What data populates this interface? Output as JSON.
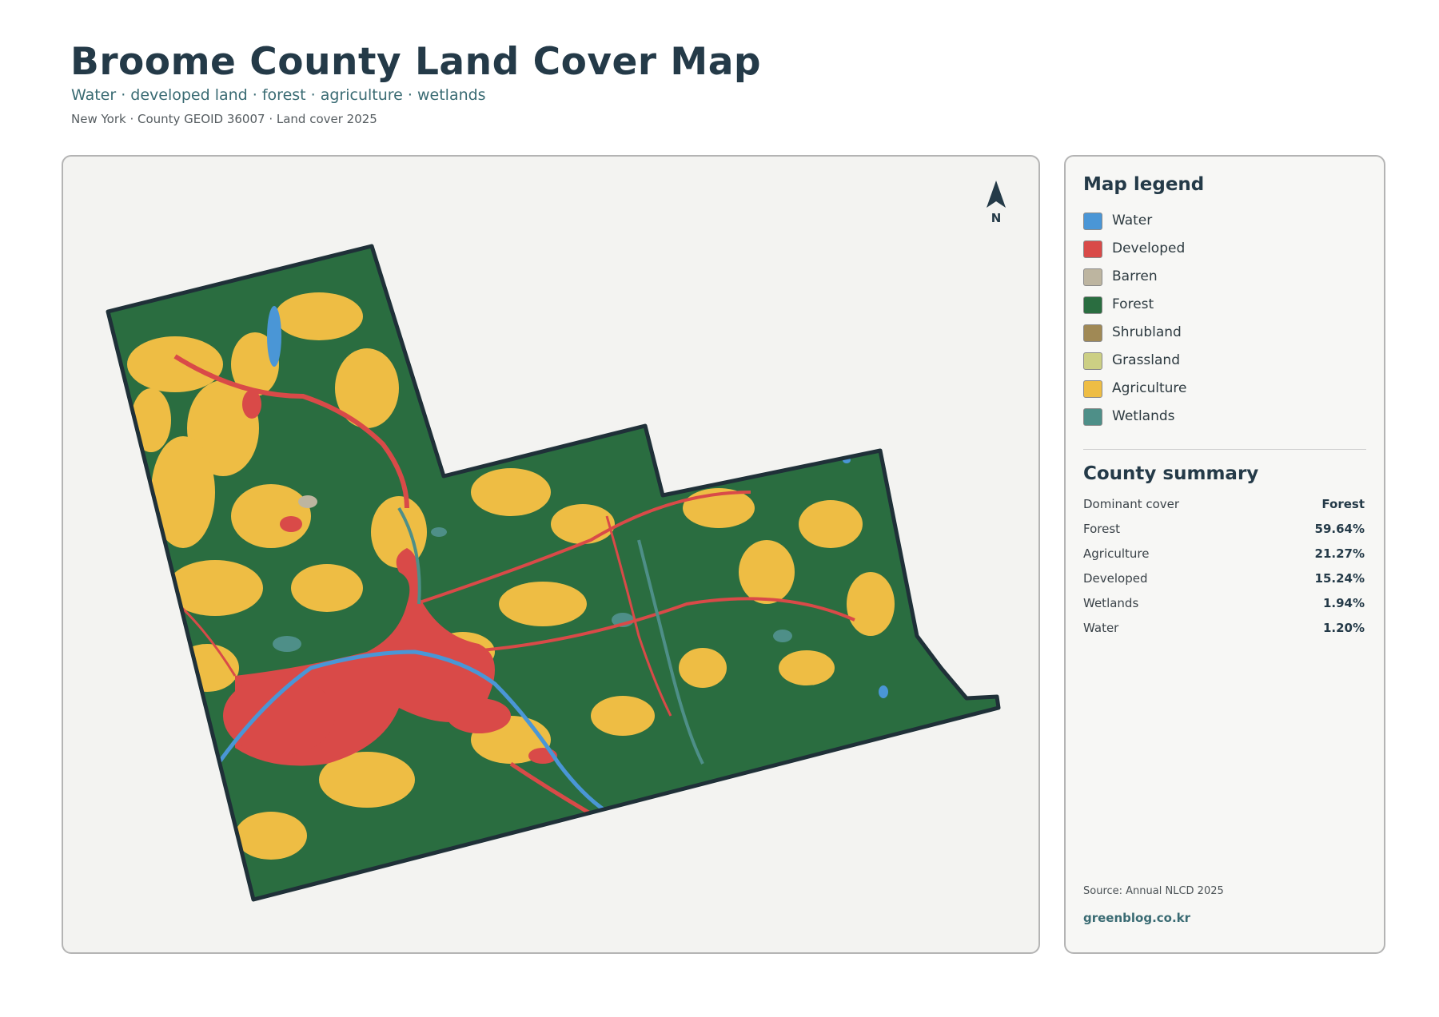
{
  "header": {
    "title": "Broome County Land Cover Map",
    "subtitle": "Water · developed land · forest · agriculture · wetlands",
    "meta": "New York · County GEOID 36007 · Land cover 2025"
  },
  "map": {
    "north_label": "N"
  },
  "legend": {
    "title": "Map legend",
    "items": [
      {
        "label": "Water",
        "color": "#4a96d6"
      },
      {
        "label": "Developed",
        "color": "#d94a48"
      },
      {
        "label": "Barren",
        "color": "#bdb5a0"
      },
      {
        "label": "Forest",
        "color": "#2a6d40"
      },
      {
        "label": "Shrubland",
        "color": "#a08955"
      },
      {
        "label": "Grassland",
        "color": "#cccf84"
      },
      {
        "label": "Agriculture",
        "color": "#eebd44"
      },
      {
        "label": "Wetlands",
        "color": "#4e8f88"
      }
    ]
  },
  "summary": {
    "title": "County summary",
    "rows": [
      {
        "label": "Dominant cover",
        "value": "Forest"
      },
      {
        "label": "Forest",
        "value": "59.64%"
      },
      {
        "label": "Agriculture",
        "value": "21.27%"
      },
      {
        "label": "Developed",
        "value": "15.24%"
      },
      {
        "label": "Wetlands",
        "value": "1.94%"
      },
      {
        "label": "Water",
        "value": "1.20%"
      }
    ]
  },
  "footer": {
    "source": "Source: Annual NLCD 2025",
    "brand": "greenblog.co.kr"
  }
}
